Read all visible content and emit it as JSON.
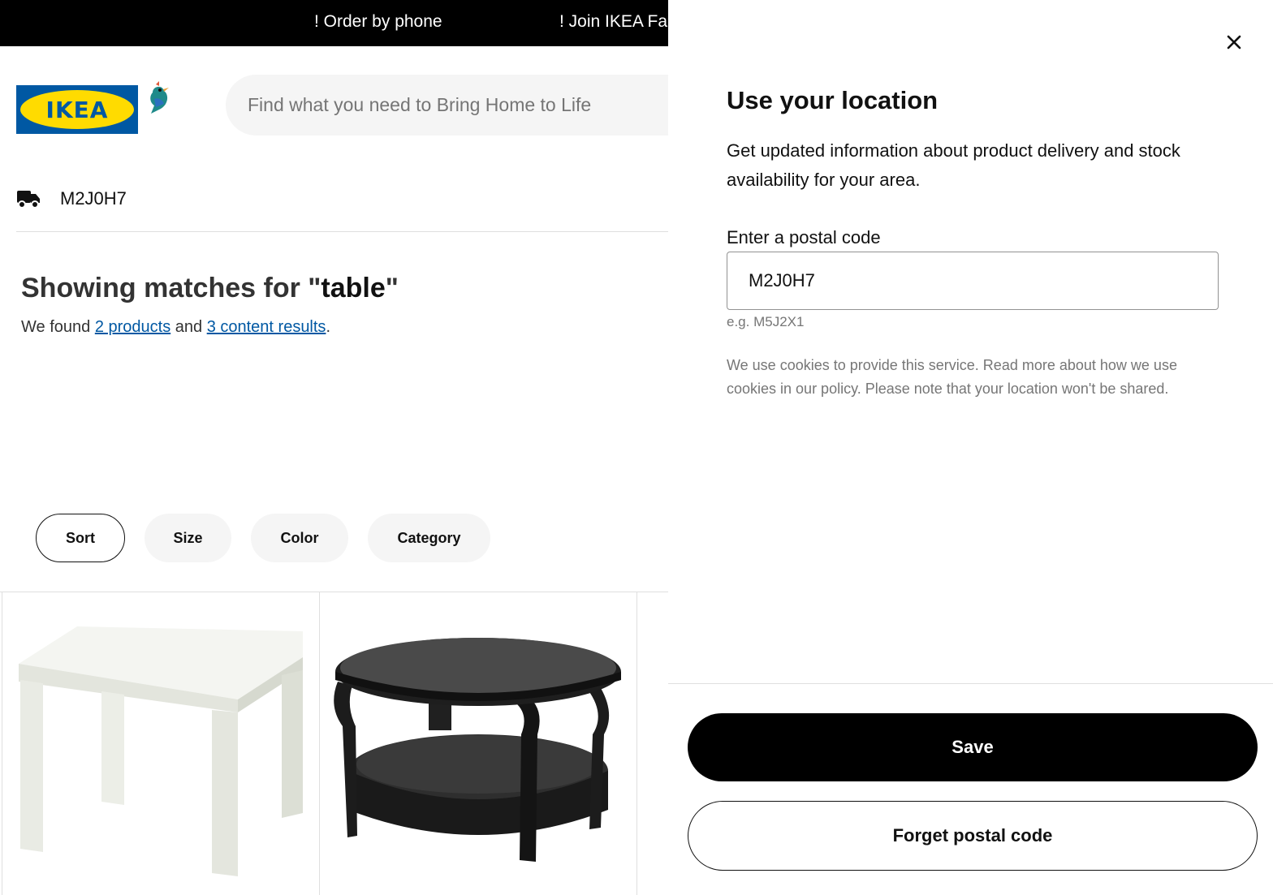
{
  "promo_bar": {
    "items": [
      "! Order by phone",
      "! Join IKEA Fam"
    ]
  },
  "header": {
    "logo_text": "IKEA",
    "search_placeholder": "Find what you need to Bring Home to Life"
  },
  "delivery": {
    "postal_code": "M2J0H7"
  },
  "results": {
    "heading_prefix": "Showing matches for \"",
    "query": "table",
    "heading_suffix": "\"",
    "found_prefix": "We found ",
    "products_link": "2 products",
    "found_middle": " and ",
    "content_link": "3 content results",
    "found_suffix": "."
  },
  "filters": [
    "Sort",
    "Size",
    "Color",
    "Category"
  ],
  "location_panel": {
    "title": "Use your location",
    "description": "Get updated information about product delivery and stock availability for your area.",
    "field_label": "Enter a postal code",
    "postal_value": "M2J0H7",
    "hint": "e.g. M5J2X1",
    "cookie_note": "We use cookies to provide this service. Read more about how we use cookies in our policy. Please note that your location won't be shared.",
    "save_label": "Save",
    "forget_label": "Forget postal code"
  },
  "colors": {
    "brand_blue": "#0058a3",
    "brand_yellow": "#ffdb00",
    "primary_button": "#000000",
    "muted_text": "#767676"
  },
  "icons": [
    "truck-icon",
    "close-icon",
    "bird-icon"
  ]
}
